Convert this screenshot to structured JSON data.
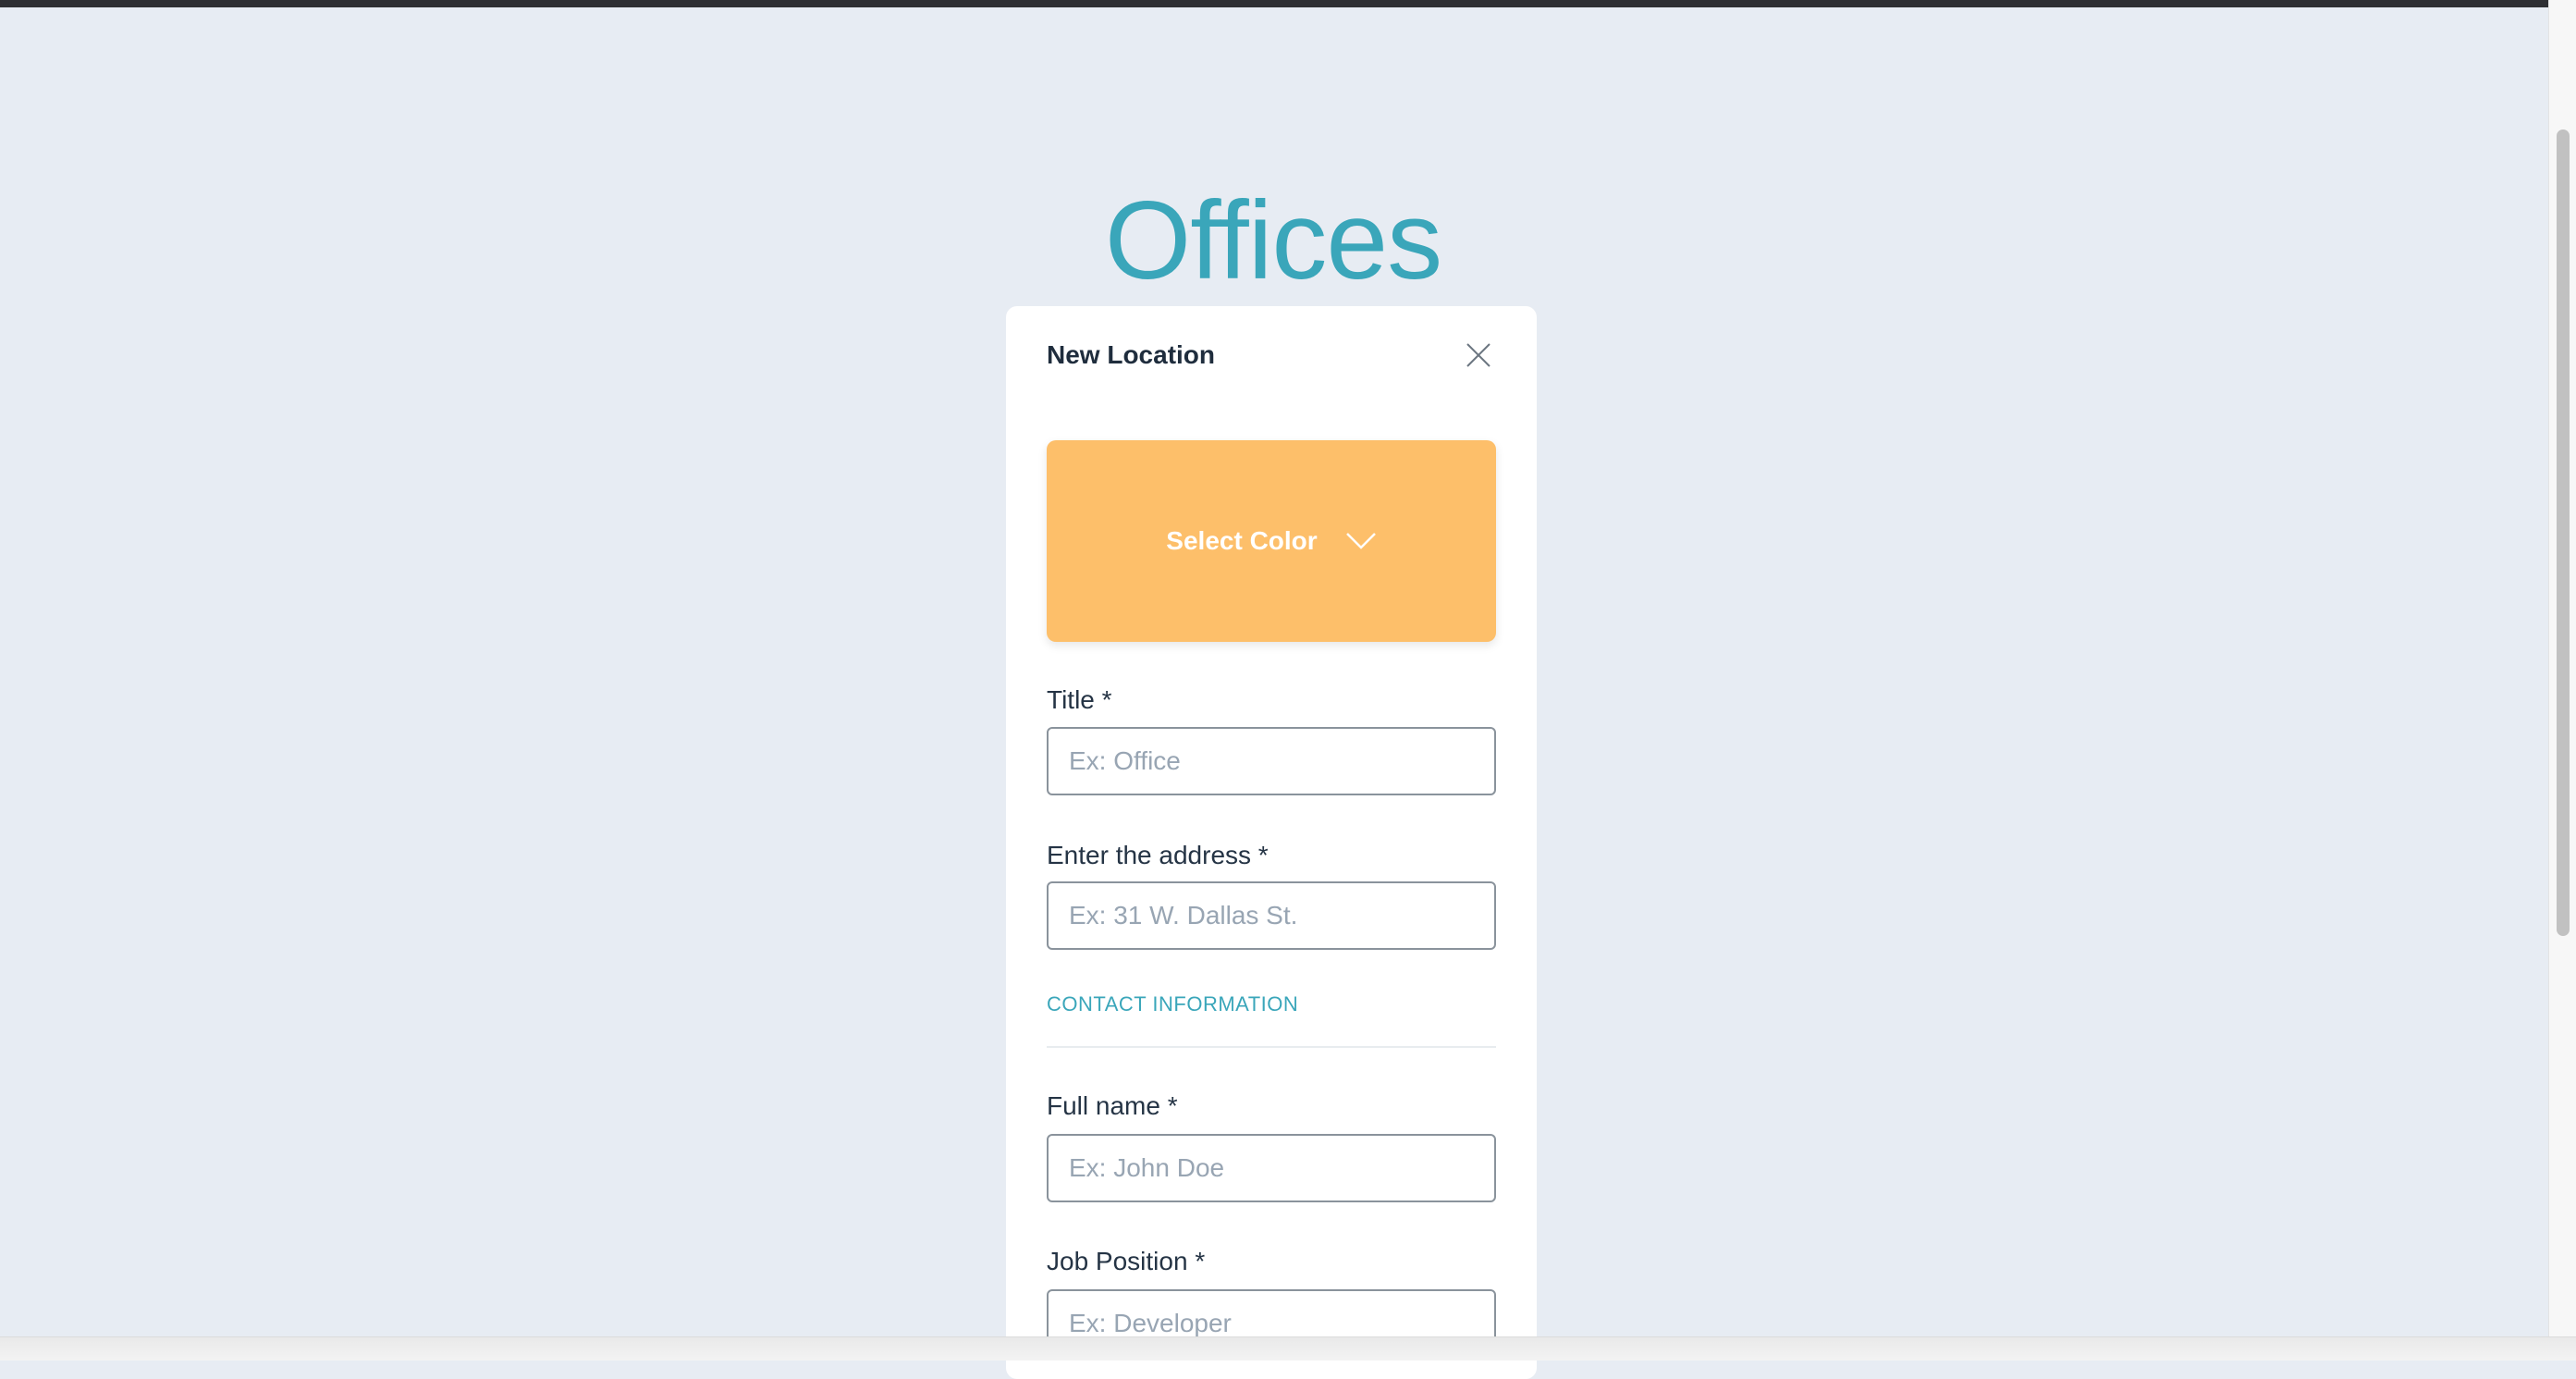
{
  "page": {
    "title": "Offices"
  },
  "modal": {
    "title": "New Location",
    "color_button_label": "Select Color",
    "color_button_bg": "#fdbf6a",
    "fields": {
      "title": {
        "label": "Title *",
        "placeholder": "Ex: Office",
        "value": ""
      },
      "address": {
        "label": "Enter the address *",
        "placeholder": "Ex: 31 W. Dallas St.",
        "value": ""
      },
      "full_name": {
        "label": "Full name *",
        "placeholder": "Ex: John Doe",
        "value": ""
      },
      "job_position": {
        "label": "Job Position *",
        "placeholder": "Ex: Developer",
        "value": ""
      }
    },
    "section_contact": "CONTACT INFORMATION"
  },
  "colors": {
    "accent": "#3aa6ba",
    "page_bg": "#e7ecf3",
    "text": "#253445"
  },
  "icons": [
    "close-icon",
    "chevron-down-icon"
  ]
}
